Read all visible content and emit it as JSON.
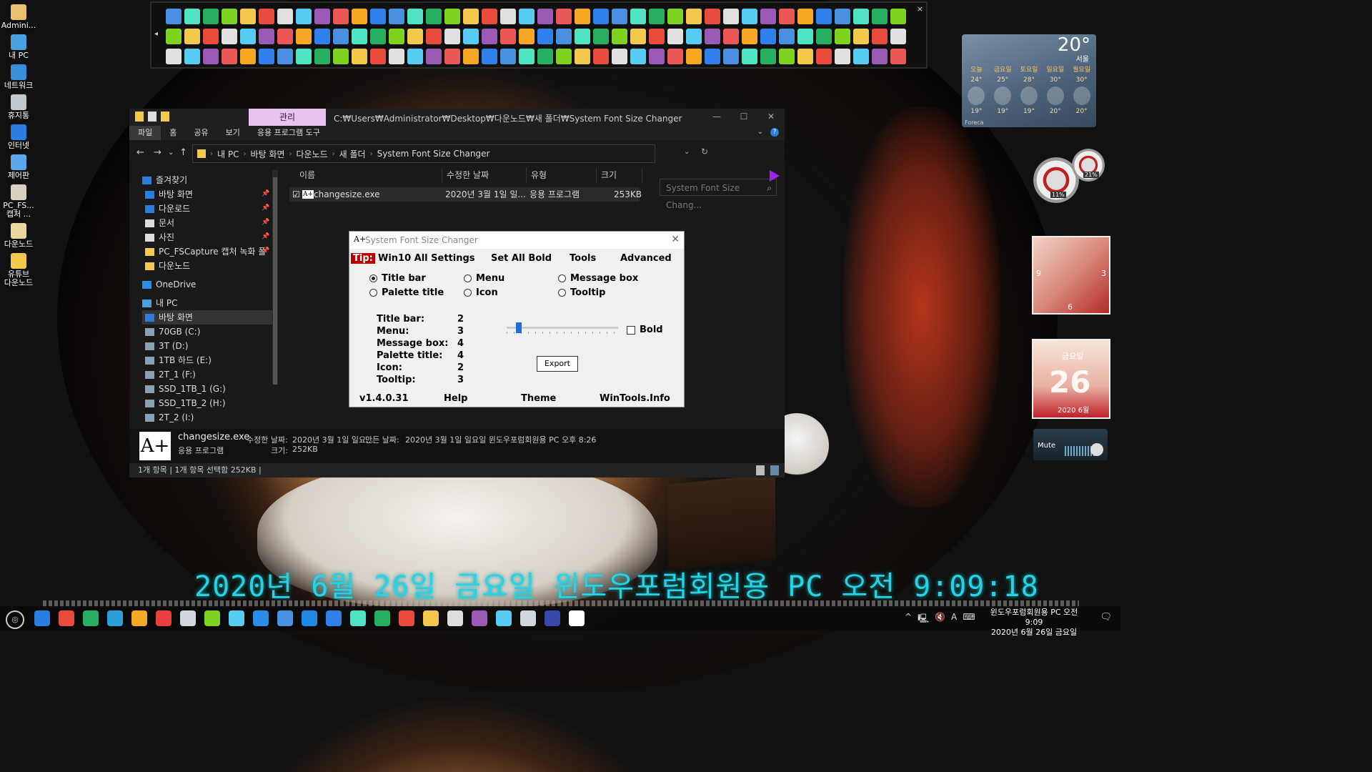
{
  "desktop": {
    "icons": [
      {
        "label": "Admini...",
        "color": "#e8c070"
      },
      {
        "label": "내 PC",
        "color": "#4aa0e0"
      },
      {
        "label": "네트워크",
        "color": "#3a90d8"
      },
      {
        "label": "휴지통",
        "color": "#c0c8d0"
      },
      {
        "label": "인터넷",
        "color": "#2a7ee0"
      },
      {
        "label": "제어판",
        "color": "#5aa8e8"
      },
      {
        "label": "PC_FS...\n캡처 ...",
        "color": "#d8d0c0"
      },
      {
        "label": "다운노드",
        "color": "#e8d8a0"
      },
      {
        "label": "유튜브\n다운노드",
        "color": "#f2c94c"
      }
    ]
  },
  "iconbar": {
    "close": "×",
    "scroll_left": "◂"
  },
  "weather": {
    "temp": "20°",
    "city": "서울",
    "source": "Foreca",
    "days": [
      {
        "day": "오늘",
        "high": "24°",
        "low": "19°"
      },
      {
        "day": "금요일",
        "high": "25°",
        "low": "19°"
      },
      {
        "day": "토요일",
        "high": "28°",
        "low": "19°"
      },
      {
        "day": "일요일",
        "high": "30°",
        "low": "20°"
      },
      {
        "day": "월요일",
        "high": "30°",
        "low": "20°"
      }
    ]
  },
  "gauges": {
    "cpu": "11%",
    "mem": "21%"
  },
  "clock_widget": {
    "n9": "9",
    "n3": "3",
    "n6": "6"
  },
  "calendar_widget": {
    "weekday": "금요일",
    "day": "26",
    "date": "2020 6월"
  },
  "volume_widget": {
    "label": "Mute"
  },
  "explorer": {
    "manage_tab": "관리",
    "path_title": "C:₩Users₩Administrator₩Desktop₩다운노드₩새 폴더₩System Font Size Changer",
    "window_buttons": {
      "min": "—",
      "max": "☐",
      "close": "✕"
    },
    "ribbon_tabs": [
      "파일",
      "홈",
      "공유",
      "보기",
      "응용 프로그램 도구"
    ],
    "nav": {
      "back": "←",
      "forward": "→",
      "recent": "⌄",
      "up": "↑"
    },
    "address": [
      "내 PC",
      "바탕 화면",
      "다운노드",
      "새 폴더",
      "System Font Size Changer"
    ],
    "address_sep": "›",
    "search_placeholder": "System Font Size Chang...",
    "nav_pane": [
      {
        "label": "즐겨찾기",
        "type": "star",
        "pinned": false
      },
      {
        "label": "바탕 화면",
        "type": "desktop",
        "pinned": true
      },
      {
        "label": "다운로드",
        "type": "download",
        "pinned": true
      },
      {
        "label": "문서",
        "type": "doc",
        "pinned": true
      },
      {
        "label": "사진",
        "type": "pic",
        "pinned": true
      },
      {
        "label": "PC_FSCapture 캡처 녹화 폴",
        "type": "folder",
        "pinned": true
      },
      {
        "label": "다운노드",
        "type": "folder",
        "pinned": false
      },
      {
        "label": "OneDrive",
        "type": "cloud",
        "pinned": false
      },
      {
        "label": "내 PC",
        "type": "pc",
        "pinned": false
      },
      {
        "label": "바탕 화면",
        "type": "desktop",
        "pinned": false
      },
      {
        "label": "70GB (C:)",
        "type": "drive",
        "pinned": false
      },
      {
        "label": "3T (D:)",
        "type": "drive",
        "pinned": false
      },
      {
        "label": "1TB 하드 (E:)",
        "type": "drive",
        "pinned": false
      },
      {
        "label": "2T_1 (F:)",
        "type": "drive",
        "pinned": false
      },
      {
        "label": "SSD_1TB_1 (G:)",
        "type": "drive",
        "pinned": false
      },
      {
        "label": "SSD_1TB_2 (H:)",
        "type": "drive",
        "pinned": false
      },
      {
        "label": "2T_2 (I:)",
        "type": "drive",
        "pinned": false
      }
    ],
    "columns": [
      "이름",
      "수정한 날짜",
      "유형",
      "크기"
    ],
    "files": [
      {
        "name": "changesize.exe",
        "modified": "2020년 3월 1일 일...",
        "type": "응용 프로그램",
        "size": "253KB"
      }
    ],
    "details": {
      "icon_text": "A+",
      "name": "changesize.exe",
      "kind": "응용 프로그램",
      "modified_label": "수정한 날짜:",
      "modified_value": "2020년 3월 1일 일요...",
      "created_label": "만든 날짜:",
      "created_value": "2020년 3월 1일 일요일 윈도우포럼회원용 PC 오후 8:26",
      "size_label": "크기:",
      "size_value": "252KB"
    },
    "status": "1개 항목  |  1개 항목 선택함 252KB  |"
  },
  "dialog": {
    "icon": "A+",
    "title": "System Font Size Changer",
    "close": "✕",
    "tip": "Tip:",
    "menu": [
      "Win10 All Settings",
      "Set All Bold",
      "Tools",
      "Advanced"
    ],
    "radios": [
      {
        "label": "Title bar",
        "checked": true
      },
      {
        "label": "Menu",
        "checked": false
      },
      {
        "label": "Message box",
        "checked": false
      },
      {
        "label": "Palette title",
        "checked": false
      },
      {
        "label": "Icon",
        "checked": false
      },
      {
        "label": "Tooltip",
        "checked": false
      }
    ],
    "sizes": [
      {
        "label": "Title bar:",
        "value": "2"
      },
      {
        "label": "Menu:",
        "value": "3"
      },
      {
        "label": "Message box:",
        "value": "4"
      },
      {
        "label": "Palette title:",
        "value": "4"
      },
      {
        "label": "Icon:",
        "value": "2"
      },
      {
        "label": "Tooltip:",
        "value": "3"
      }
    ],
    "bold_label": "Bold",
    "bold_checked": false,
    "export_label": "Export",
    "version": "v1.4.0.31",
    "help": "Help",
    "theme": "Theme",
    "site": "WinTools.Info"
  },
  "overlay_clock": "2020년 6월 26일 금요일 윈도우포럼회원용 PC 오전 9:09:18",
  "taskbar": {
    "start": "(◎)",
    "tray": [
      "^",
      "🖳",
      "🔇",
      "A",
      "⌨"
    ],
    "clock_line1": "윈도우포럼회원용 PC 오전 9:09",
    "clock_line2": "2020년 6월 26일 금요일",
    "notifications": "🗨"
  }
}
